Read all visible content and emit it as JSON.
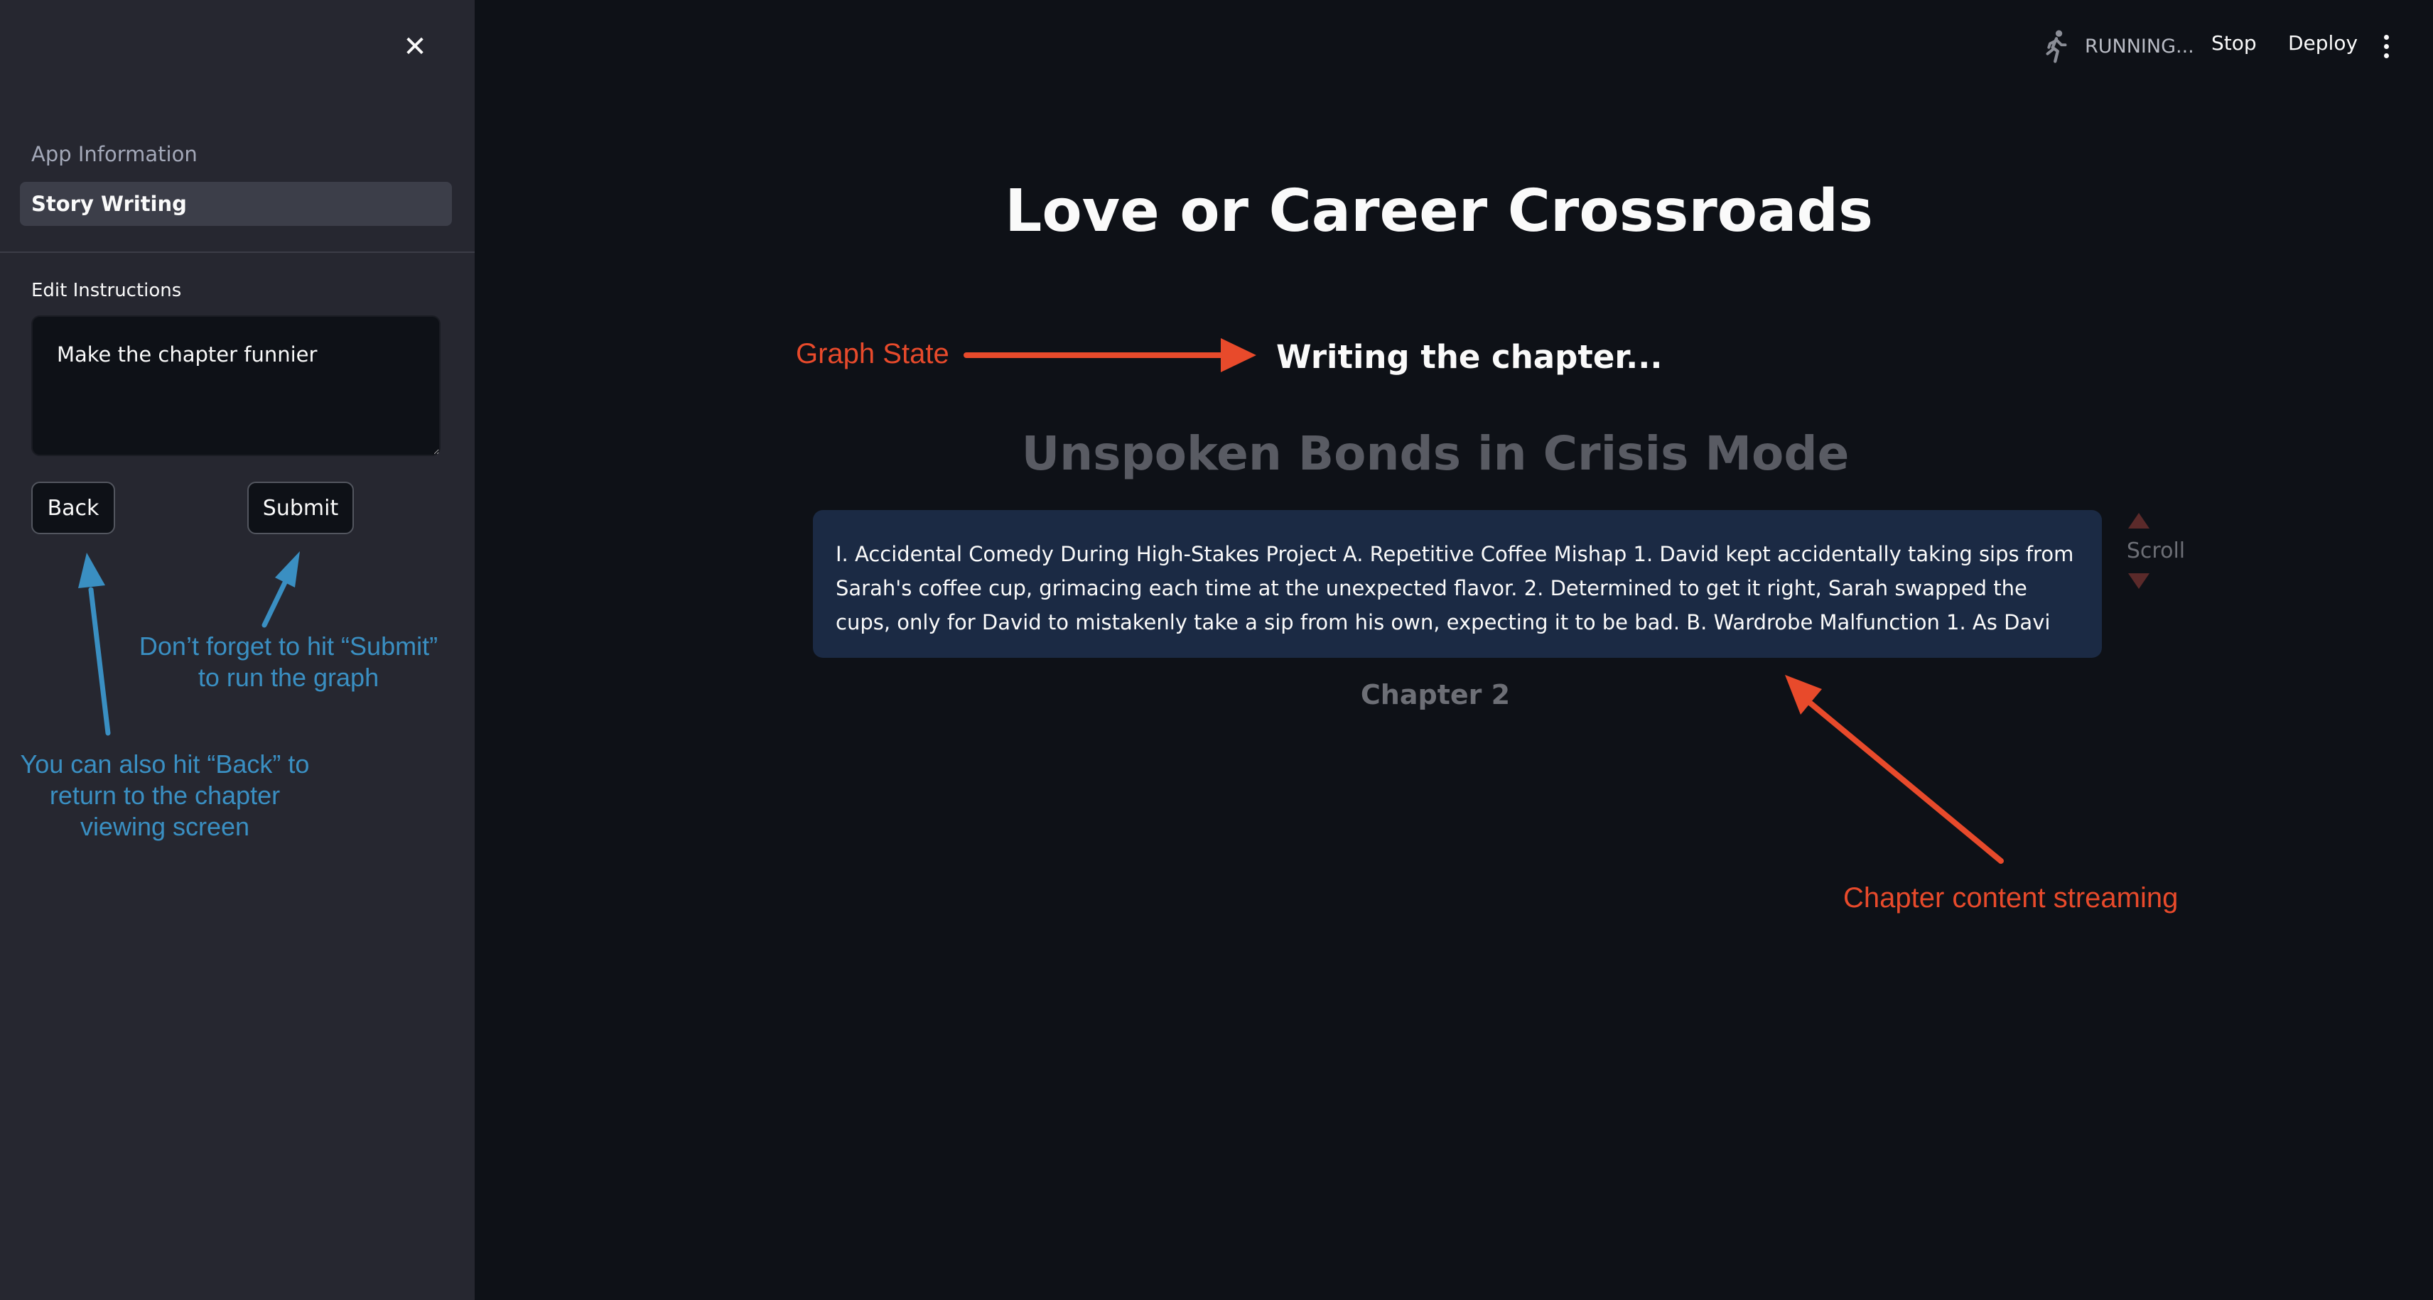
{
  "sidebar": {
    "nav": [
      {
        "label": "App Information",
        "selected": false
      },
      {
        "label": "Story Writing",
        "selected": true
      }
    ],
    "edit_label": "Edit Instructions",
    "instructions_value": "Make the chapter funnier",
    "back_label": "Back",
    "submit_label": "Submit"
  },
  "topbar": {
    "status": "RUNNING...",
    "stop_label": "Stop",
    "deploy_label": "Deploy"
  },
  "main": {
    "title": "Love or Career Crossroads",
    "graph_state": "Writing the chapter...",
    "chapter_title": "Unspoken Bonds in Crisis Mode",
    "chapter_text": "I. Accidental Comedy During High-Stakes Project A. Repetitive Coffee Mishap 1. David kept accidentally taking sips from Sarah's coffee cup, grimacing each time at the unexpected flavor. 2. Determined to get it right, Sarah swapped the cups, only for David to mistakenly take a sip from his own, expecting it to be bad. B. Wardrobe Malfunction 1. As Davi",
    "scroll_label": "Scroll",
    "chapter_nav": "Chapter 2"
  },
  "annotations": {
    "submit_hint": "Don’t forget to hit “Submit”\nto run the graph",
    "back_hint": "You can also hit “Back” to\nreturn to the chapter\nviewing screen",
    "graph_state_hint": "Graph State",
    "streaming_hint": "Chapter content streaming"
  },
  "colors": {
    "background": "#0e1117",
    "sidebar": "#262730",
    "content_box": "#1b2a44",
    "annotation_blue": "#3a8fc2",
    "annotation_red": "#e84a2b"
  }
}
